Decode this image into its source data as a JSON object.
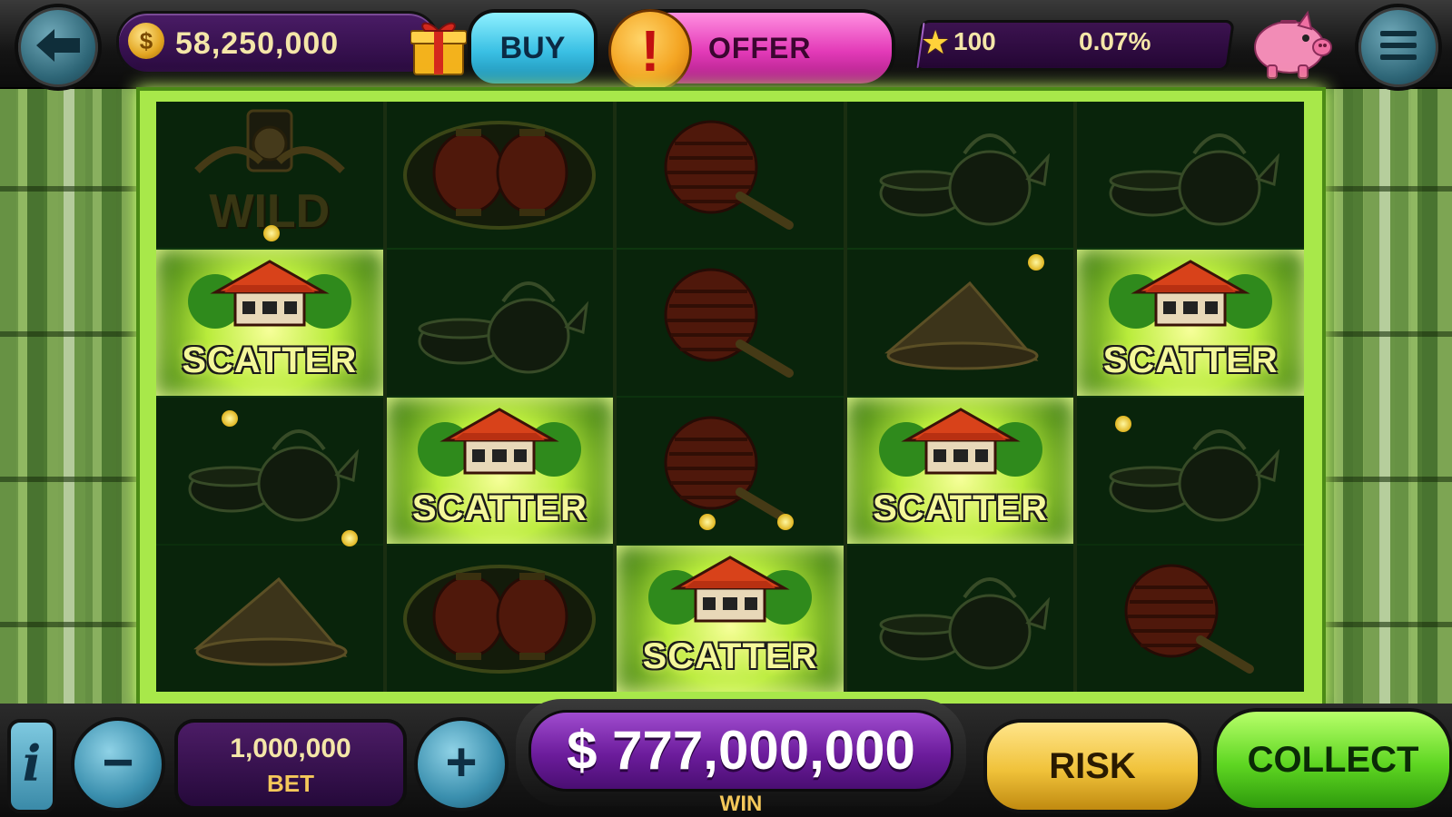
{
  "top_bar": {
    "balance": "58,250,000",
    "coin_symbol": "$",
    "buy_label": "BUY",
    "offer_label": "OFFER",
    "offer_alert": "!",
    "level": "100",
    "level_progress_text": "0.07%",
    "level_progress": 0.0007,
    "icons": [
      "back-arrow-icon",
      "coin-icon",
      "gift-icon",
      "alert-icon",
      "star-icon",
      "piggy-bank-icon",
      "menu-icon"
    ]
  },
  "reels": [
    [
      {
        "symbol": "wild",
        "label": "WILD",
        "highlight": false
      },
      {
        "symbol": "scatter",
        "label": "SCATTER",
        "highlight": true
      },
      {
        "symbol": "teapot",
        "label": "",
        "highlight": false
      },
      {
        "symbol": "hat",
        "label": "",
        "highlight": false
      }
    ],
    [
      {
        "symbol": "lanterns",
        "label": "",
        "highlight": false
      },
      {
        "symbol": "teapot",
        "label": "",
        "highlight": false
      },
      {
        "symbol": "scatter",
        "label": "SCATTER",
        "highlight": true
      },
      {
        "symbol": "lanterns",
        "label": "",
        "highlight": false
      }
    ],
    [
      {
        "symbol": "fan",
        "label": "",
        "highlight": false
      },
      {
        "symbol": "fan",
        "label": "",
        "highlight": false
      },
      {
        "symbol": "fan",
        "label": "",
        "highlight": false
      },
      {
        "symbol": "scatter",
        "label": "SCATTER",
        "highlight": true
      }
    ],
    [
      {
        "symbol": "teapot",
        "label": "",
        "highlight": false
      },
      {
        "symbol": "hat",
        "label": "",
        "highlight": false
      },
      {
        "symbol": "scatter",
        "label": "SCATTER",
        "highlight": true
      },
      {
        "symbol": "teapot",
        "label": "",
        "highlight": false
      }
    ],
    [
      {
        "symbol": "teapot",
        "label": "",
        "highlight": false
      },
      {
        "symbol": "scatter",
        "label": "SCATTER",
        "highlight": true
      },
      {
        "symbol": "teapot",
        "label": "",
        "highlight": false
      },
      {
        "symbol": "fan",
        "label": "",
        "highlight": false
      }
    ]
  ],
  "bottom_bar": {
    "info_label": "i",
    "minus_label": "−",
    "plus_label": "+",
    "bet_value": "1,000,000",
    "bet_label": "BET",
    "win_value": "$ 777,000,000",
    "win_label": "WIN",
    "risk_label": "RISK",
    "collect_label": "COLLECT"
  },
  "colors": {
    "frame_glow": "#a8e84a",
    "buy": "#3ac0e4",
    "offer": "#e33ab8",
    "collect": "#5ed622",
    "risk": "#f0c23a",
    "win_panel": "#6c1c9c"
  }
}
